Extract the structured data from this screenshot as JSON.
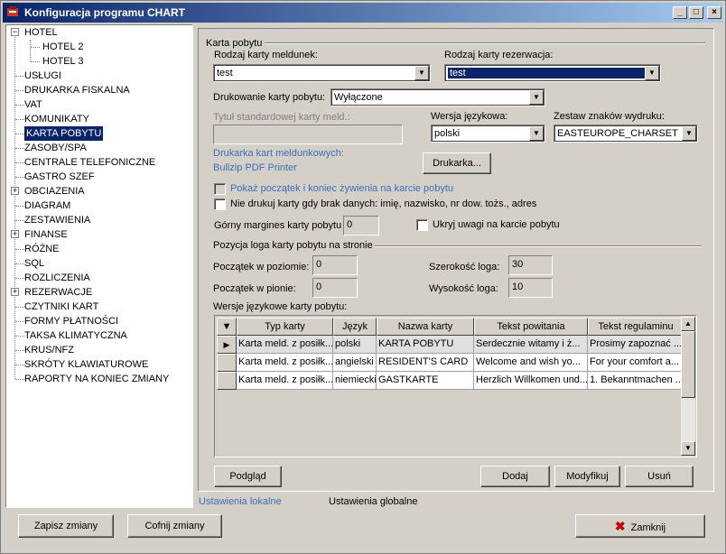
{
  "window": {
    "title": "Konfiguracja programu CHART",
    "minimize": "_",
    "maximize": "□",
    "close": "×"
  },
  "tree": {
    "items": [
      {
        "label": "HOTEL",
        "expander": "−"
      },
      {
        "label": "HOTEL 2"
      },
      {
        "label": "HOTEL 3"
      },
      {
        "label": "USŁUGI"
      },
      {
        "label": "DRUKARKA FISKALNA"
      },
      {
        "label": "VAT"
      },
      {
        "label": "KOMUNIKATY"
      },
      {
        "label": "KARTA POBYTU",
        "selected": true
      },
      {
        "label": "ZASOBY/SPA"
      },
      {
        "label": "CENTRALE TELEFONICZNE"
      },
      {
        "label": "GASTRO SZEF"
      },
      {
        "label": "OBCIAZENIA",
        "expander": "+"
      },
      {
        "label": "DIAGRAM"
      },
      {
        "label": "ZESTAWIENIA"
      },
      {
        "label": "FINANSE",
        "expander": "+"
      },
      {
        "label": "RÓŻNE"
      },
      {
        "label": "SQL"
      },
      {
        "label": "ROZLICZENIA"
      },
      {
        "label": "REZERWACJE",
        "expander": "+"
      },
      {
        "label": "CZYTNIKI KART"
      },
      {
        "label": "FORMY PŁATNOŚCI"
      },
      {
        "label": "TAKSA KLIMATYCZNA"
      },
      {
        "label": "KRUS/NFZ"
      },
      {
        "label": "SKRÓTY KLAWIATUROWE"
      },
      {
        "label": "RAPORTY NA KONIEC ZMIANY"
      }
    ]
  },
  "panel": {
    "group_title": "Karta pobytu",
    "rodzaj_meldunek_label": "Rodzaj karty meldunek:",
    "rodzaj_meldunek_value": "test",
    "rodzaj_rezerwacja_label": "Rodzaj karty rezerwacja:",
    "rodzaj_rezerwacja_value": "test",
    "drukowanie_label": "Drukowanie karty pobytu:",
    "drukowanie_value": "Wyłączone",
    "tytul_label": "Tytuł standardowej karty meld.:",
    "tytul_value": "",
    "wersja_label": "Wersja językowa:",
    "wersja_value": "polski",
    "zestaw_label": "Zestaw znaków wydruku:",
    "zestaw_value": "EASTEUROPE_CHARSET",
    "drukarka_label": "Drukarka kart meldunkowych:",
    "drukarka_value": "Bullzip PDF Printer",
    "drukarka_button": "Drukarka...",
    "chk_poczatek": "Pokaż początek i koniec żywienia na karcie pobytu",
    "chk_nie_drukuj": "Nie drukuj karty gdy brak danych: imię, nazwisko, nr dow. tożs., adres",
    "margines_label": "Górny margines karty pobytu",
    "margines_value": "0",
    "chk_ukryj": "Ukryj uwagi na karcie pobytu",
    "pozycja_title": "Pozycja loga karty pobytu na stronie",
    "poczatek_poziom_label": "Początek w poziomie:",
    "poczatek_poziom_value": "0",
    "poczatek_pion_label": "Początek w pionie:",
    "poczatek_pion_value": "0",
    "szerokosc_label": "Szerokość loga:",
    "szerokosc_value": "30",
    "wysokosc_label": "Wysokość loga:",
    "wysokosc_value": "10",
    "wersje_label": "Wersje językowe karty pobytu:",
    "grid": {
      "columns": [
        "Typ karty",
        "Język",
        "Nazwa karty",
        "Tekst powitania",
        "Tekst regulaminu"
      ],
      "rows": [
        [
          "Karta meld. z posiłk...",
          "polski",
          "KARTA POBYTU",
          "Serdecznie witamy i ż...",
          "Prosimy zapoznać ..."
        ],
        [
          "Karta meld. z posiłk...",
          "angielski",
          "RESIDENT'S CARD",
          "Welcome and wish yo...",
          "For your comfort a..."
        ],
        [
          "Karta meld. z posiłk...",
          "niemiecki",
          "GASTKARTE",
          "Herzlich Willkomen und...",
          "1. Bekanntmachen ..."
        ]
      ]
    },
    "btn_podglad": "Podgląd",
    "btn_dodaj": "Dodaj",
    "btn_modyfikuj": "Modyfikuj",
    "btn_usun": "Usuń"
  },
  "tabs": {
    "local": "Ustawienia lokalne",
    "global": "Ustawienia globalne"
  },
  "footer": {
    "save": "Zapisz zmiany",
    "revert": "Cofnij zmiany",
    "close": "Zamknij"
  }
}
